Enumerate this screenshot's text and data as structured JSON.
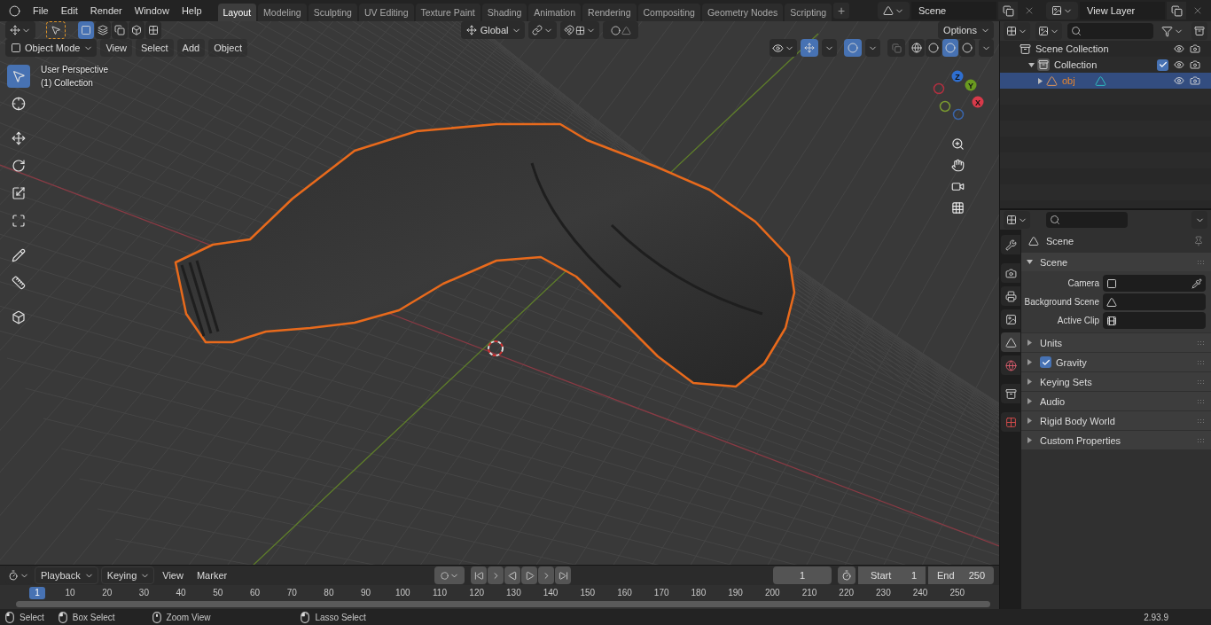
{
  "menu": [
    "File",
    "Edit",
    "Render",
    "Window",
    "Help"
  ],
  "workspaces": [
    {
      "label": "Layout",
      "selected": true
    },
    {
      "label": "Modeling",
      "selected": false
    },
    {
      "label": "Sculpting",
      "selected": false
    },
    {
      "label": "UV Editing",
      "selected": false
    },
    {
      "label": "Texture Paint",
      "selected": false
    },
    {
      "label": "Shading",
      "selected": false
    },
    {
      "label": "Animation",
      "selected": false
    },
    {
      "label": "Rendering",
      "selected": false
    },
    {
      "label": "Compositing",
      "selected": false
    },
    {
      "label": "Geometry Nodes",
      "selected": false
    },
    {
      "label": "Scripting",
      "selected": false
    }
  ],
  "add_workspace": "+",
  "scene_field": {
    "value": "Scene"
  },
  "view_layer_field": {
    "value": "View Layer"
  },
  "viewport": {
    "select_modes": [
      {
        "kind": "set",
        "selected": true
      },
      {
        "kind": "extend",
        "selected": false
      },
      {
        "kind": "subtract",
        "selected": false
      },
      {
        "kind": "invert",
        "selected": false
      },
      {
        "kind": "intersect",
        "selected": false
      }
    ],
    "orientation": "Global",
    "options": "Options",
    "mode": "Object Mode",
    "menus": [
      "View",
      "Select",
      "Add",
      "Object"
    ],
    "shading": [
      {
        "kind": "wireframe",
        "selected": false
      },
      {
        "kind": "solid",
        "selected": false
      },
      {
        "kind": "material",
        "selected": true
      },
      {
        "kind": "rendered",
        "selected": false
      }
    ],
    "overlay_text": [
      "User Perspective",
      "(1) Collection"
    ],
    "tools": [
      {
        "kind": "select",
        "selected": true
      },
      {
        "kind": "cursor",
        "selected": false
      },
      {
        "kind": "move",
        "selected": false
      },
      {
        "kind": "rotate",
        "selected": false
      },
      {
        "kind": "scale",
        "selected": false
      },
      {
        "kind": "transform",
        "selected": false
      },
      {
        "kind": "annotate",
        "selected": false
      },
      {
        "kind": "measure",
        "selected": false
      },
      {
        "kind": "add-cube",
        "selected": false
      }
    ],
    "gizmo_axes": [
      "Z",
      "Y",
      "X"
    ]
  },
  "outliner": {
    "items": [
      {
        "kind": "root",
        "label": "Scene Collection",
        "children": [
          {
            "kind": "collection",
            "label": "Collection",
            "expanded": true,
            "checked": true,
            "selected": false,
            "children": [
              {
                "kind": "object",
                "label": "obj",
                "expanded": false,
                "selected": true
              }
            ]
          }
        ]
      }
    ]
  },
  "properties": {
    "tabs": [
      {
        "kind": "tool",
        "selected": false
      },
      {
        "kind": "render",
        "selected": false
      },
      {
        "kind": "output",
        "selected": false
      },
      {
        "kind": "view-layer",
        "selected": false
      },
      {
        "kind": "scene",
        "selected": true
      },
      {
        "kind": "world",
        "selected": false
      },
      {
        "kind": "collection",
        "selected": false
      },
      {
        "kind": "texture",
        "selected": false
      }
    ],
    "context": "Scene",
    "section": {
      "label": "Scene",
      "expanded": true,
      "fields": [
        {
          "kind": "camera",
          "label": "Camera"
        },
        {
          "kind": "scene",
          "label": "Background Scene"
        },
        {
          "kind": "clip",
          "label": "Active Clip"
        }
      ]
    },
    "panels": [
      {
        "kind": "plain",
        "label": "Units"
      },
      {
        "kind": "checkbox",
        "label": "Gravity",
        "checked": true
      },
      {
        "kind": "plain",
        "label": "Keying Sets"
      },
      {
        "kind": "plain",
        "label": "Audio"
      },
      {
        "kind": "plain",
        "label": "Rigid Body World"
      },
      {
        "kind": "plain",
        "label": "Custom Properties"
      }
    ]
  },
  "timeline": {
    "menus": [
      {
        "kind": "dropdown",
        "label": "Playback"
      },
      {
        "kind": "dropdown",
        "label": "Keying"
      },
      {
        "kind": "menu",
        "label": "View"
      },
      {
        "kind": "menu",
        "label": "Marker"
      }
    ],
    "current_frame": "1",
    "start_label": "Start",
    "start": "1",
    "end_label": "End",
    "end": "250",
    "playhead": "1",
    "ruler": [
      "10",
      "20",
      "30",
      "40",
      "50",
      "60",
      "70",
      "80",
      "90",
      "100",
      "110",
      "120",
      "130",
      "140",
      "150",
      "160",
      "170",
      "180",
      "190",
      "200",
      "210",
      "220",
      "230",
      "240",
      "250"
    ]
  },
  "status_bar": {
    "hints": [
      {
        "kind": "left",
        "label": "Select"
      },
      {
        "kind": "drag",
        "label": "Box Select"
      },
      {
        "kind": "middle",
        "label": "Zoom View"
      },
      {
        "kind": "drag",
        "label": "Lasso Select"
      }
    ],
    "version": "2.93.9"
  }
}
